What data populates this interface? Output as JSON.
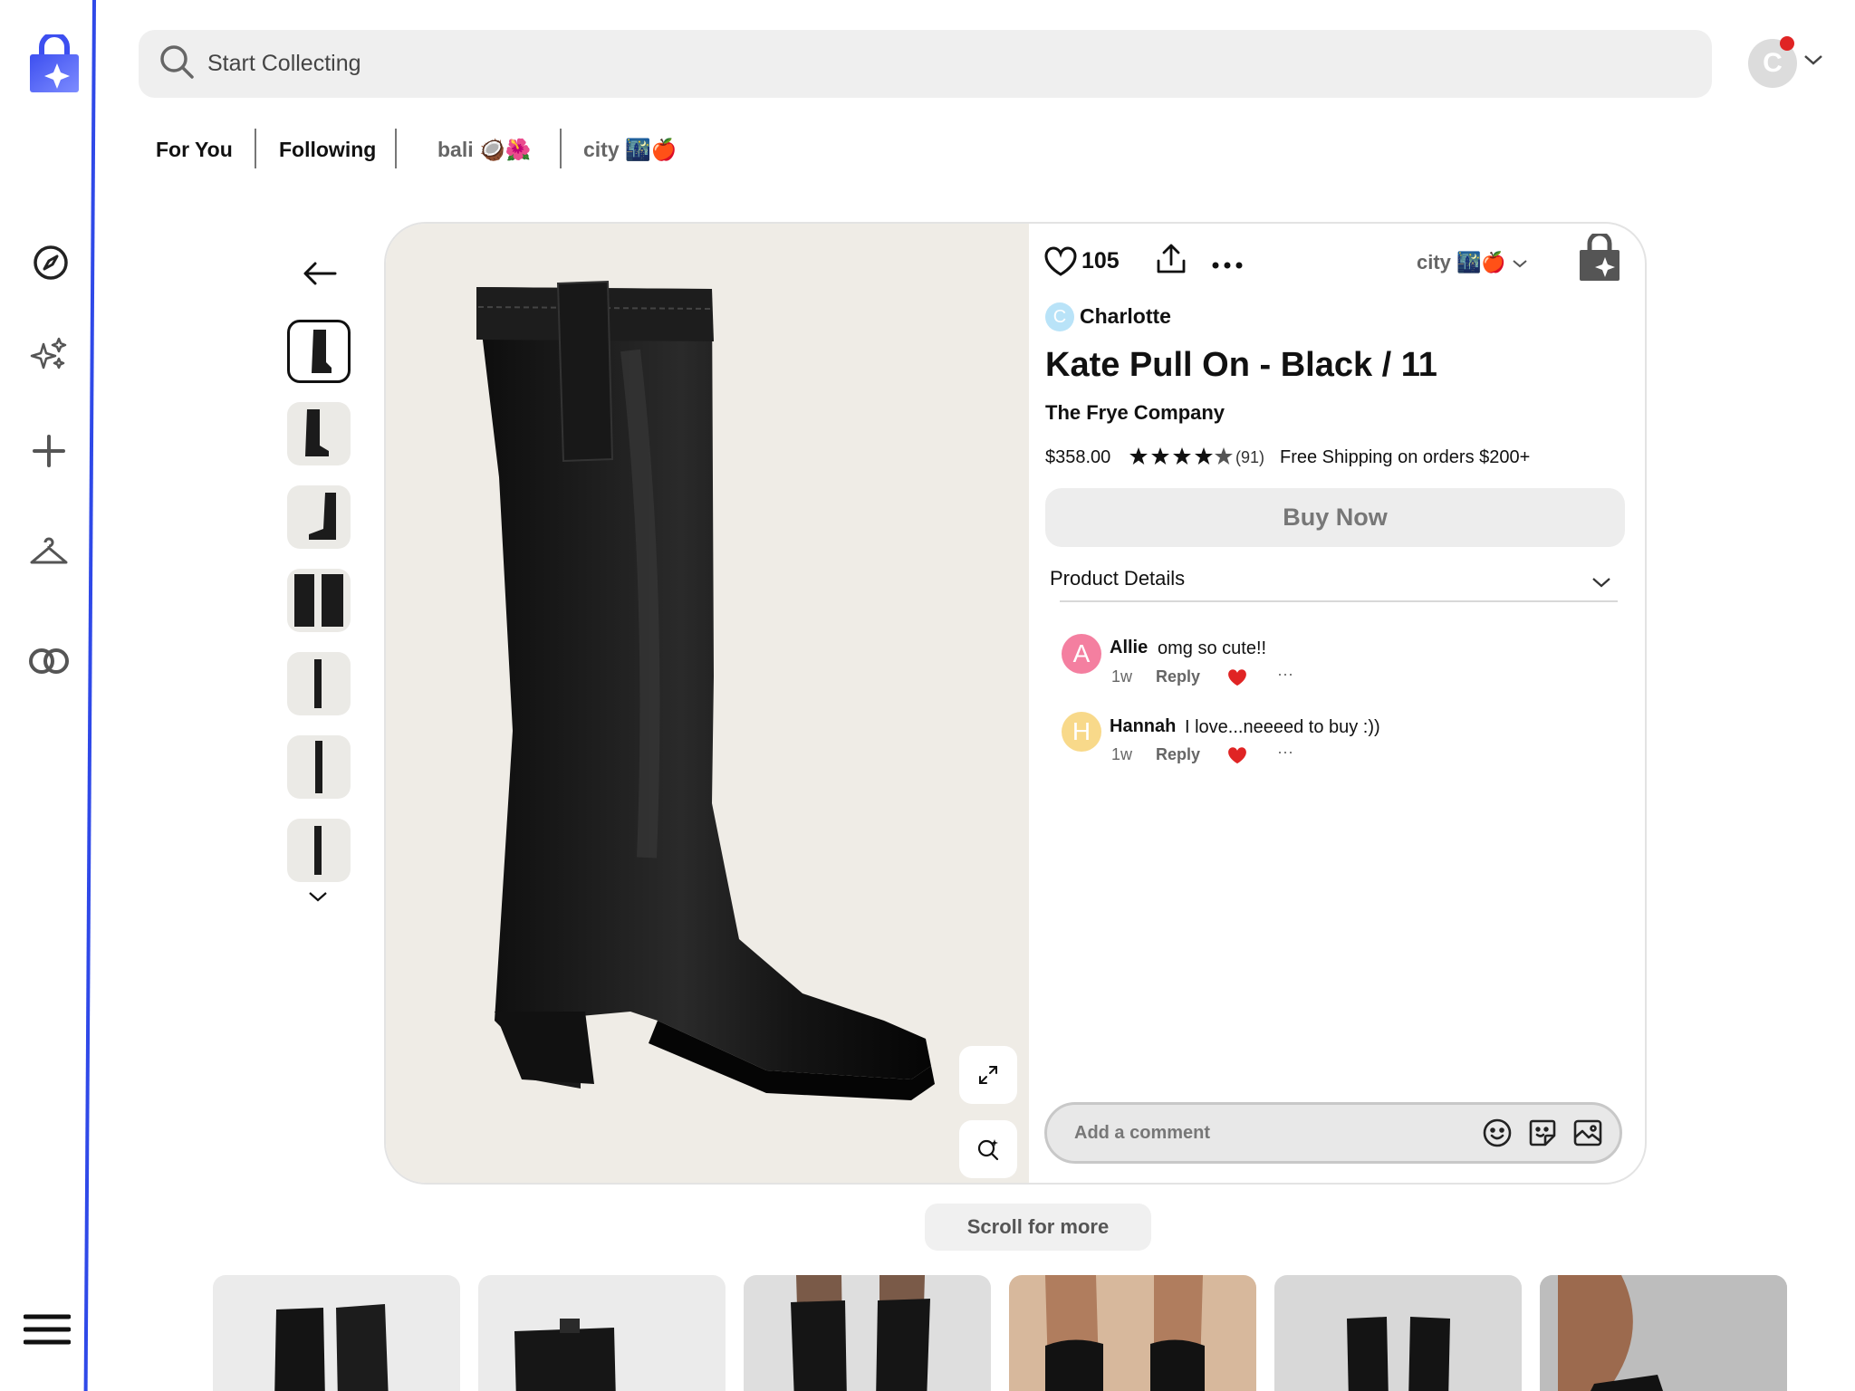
{
  "search": {
    "placeholder": "Start Collecting"
  },
  "user": {
    "initial": "C"
  },
  "tabs": [
    {
      "label": "For You"
    },
    {
      "label": "Following"
    },
    {
      "label": "bali 🥥🌺"
    },
    {
      "label": "city 🌃🍎"
    }
  ],
  "sidebar": {
    "items": [
      "compass-icon",
      "sparkles-icon",
      "plus-icon",
      "hanger-icon",
      "rings-icon",
      "menu-icon"
    ]
  },
  "product": {
    "likes": "105",
    "collection": "city 🌃🍎",
    "curator_initial": "C",
    "curator": "Charlotte",
    "title": "Kate Pull On - Black / 11",
    "brand": "The Frye Company",
    "price": "$358.00",
    "rating": 4.5,
    "review_count": "(91)",
    "shipping": "Free Shipping on orders $200+",
    "buy_label": "Buy Now",
    "details_label": "Product Details"
  },
  "comments": [
    {
      "initial": "A",
      "name": "Allie",
      "text": "omg so cute!!",
      "time": "1w",
      "reply": "Reply",
      "more": "···",
      "color": "#f47fa0"
    },
    {
      "initial": "H",
      "name": "Hannah",
      "text": "I love...neeeed to buy :))",
      "time": "1w",
      "reply": "Reply",
      "more": "···",
      "color": "#f8d98a"
    }
  ],
  "comment_input": {
    "placeholder": "Add a comment"
  },
  "scroll_more": "Scroll for more",
  "colors": {
    "accent": "#2f49e8",
    "heart": "#e02424",
    "brand_gradient": [
      "#3d4ff0",
      "#6b7bff"
    ]
  }
}
